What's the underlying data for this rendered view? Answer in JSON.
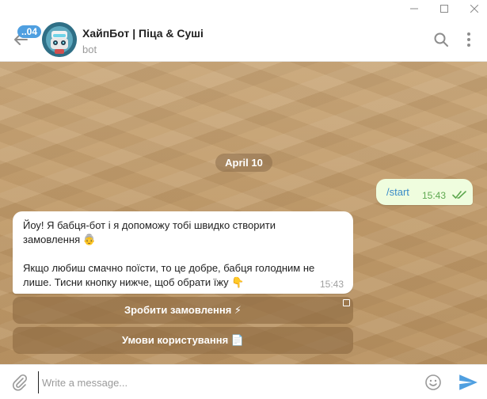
{
  "window": {
    "minimize_icon": "minimize-icon",
    "maximize_icon": "maximize-icon",
    "close_icon": "close-icon"
  },
  "header": {
    "unread_count": "..04",
    "title": "ХайпБот | Піца & Суші",
    "subtitle": "bot",
    "icons": [
      "back-arrow-icon",
      "search-icon",
      "more-vertical-icon"
    ]
  },
  "chat": {
    "date_separator": "April 10",
    "messages": [
      {
        "direction": "out",
        "text": "/start",
        "time": "15:43",
        "status": "read"
      },
      {
        "direction": "in",
        "text": "Йоу! Я бабця-бот і я допоможу тобі швидко створити\nзамовлення 👵\n\nЯкщо любиш смачно поїсти, то це добре, бабця голодним не\nлише. Тисни кнопку нижче, щоб обрати їжу 👇",
        "time": "15:43"
      }
    ],
    "keyboard": [
      {
        "label": "Зробити замовлення ⚡"
      },
      {
        "label": "Умови користування 📄"
      }
    ]
  },
  "composer": {
    "placeholder": "Write a message...",
    "value": "",
    "icons": [
      "paperclip-icon",
      "emoji-icon",
      "send-icon"
    ]
  },
  "colors": {
    "accent": "#4f9fe0",
    "outgoing_bubble": "#effdde",
    "tick": "#5ea84f"
  }
}
